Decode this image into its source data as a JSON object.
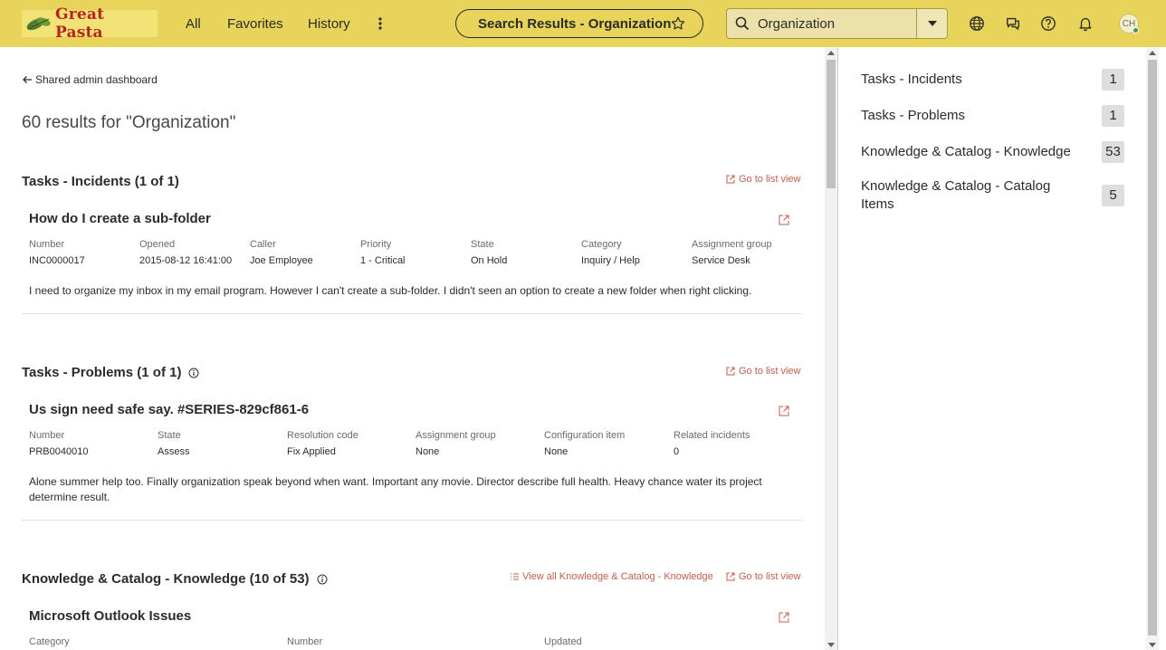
{
  "header": {
    "logo_text": "Great Pasta",
    "nav": [
      "All",
      "Favorites",
      "History"
    ],
    "page_title": "Search Results - Organization",
    "search_value": "Organization",
    "avatar_initials": "CH",
    "colors": {
      "bar": "#e8d45a",
      "link": "#c15e4e"
    }
  },
  "main": {
    "back_label": "Shared admin dashboard",
    "results_title": "60 results for \"Organization\"",
    "go_to_list": "Go to list view",
    "incidents": {
      "heading": "Tasks - Incidents (1 of 1)",
      "record_title": "How do I create a sub-folder",
      "fields": [
        {
          "label": "Number",
          "value": "INC0000017"
        },
        {
          "label": "Opened",
          "value": "2015-08-12 16:41:00"
        },
        {
          "label": "Caller",
          "value": "Joe Employee"
        },
        {
          "label": "Priority",
          "value": "1 - Critical"
        },
        {
          "label": "State",
          "value": "On Hold"
        },
        {
          "label": "Category",
          "value": "Inquiry / Help"
        },
        {
          "label": "Assignment group",
          "value": "Service Desk"
        }
      ],
      "description": "I need to organize my inbox in my email program. However I can't create a sub-folder. I didn't seen an option to create a new folder when right clicking."
    },
    "problems": {
      "heading": "Tasks - Problems (1 of 1)",
      "record_title": "Us sign need safe say. #SERIES-829cf861-6",
      "fields": [
        {
          "label": "Number",
          "value": "PRB0040010"
        },
        {
          "label": "State",
          "value": "Assess"
        },
        {
          "label": "Resolution code",
          "value": "Fix Applied"
        },
        {
          "label": "Assignment group",
          "value": "None"
        },
        {
          "label": "Configuration item",
          "value": "None"
        },
        {
          "label": "Related incidents",
          "value": "0"
        }
      ],
      "description": "Alone summer help too. Finally organization speak beyond when want. Important any movie. Director describe full health. Heavy chance water its project determine result."
    },
    "knowledge": {
      "heading": "Knowledge & Catalog - Knowledge (10 of 53)",
      "view_all": "View all Knowledge & Catalog - Knowledge",
      "record_title": "Microsoft Outlook Issues",
      "fields": [
        {
          "label": "Category"
        },
        {
          "label": "Number"
        },
        {
          "label": "Updated"
        }
      ]
    }
  },
  "side": {
    "items": [
      {
        "name": "Tasks - Incidents",
        "count": "1"
      },
      {
        "name": "Tasks - Problems",
        "count": "1"
      },
      {
        "name": "Knowledge & Catalog - Knowledge",
        "count": "53"
      },
      {
        "name": "Knowledge & Catalog - Catalog Items",
        "count": "5"
      }
    ]
  }
}
